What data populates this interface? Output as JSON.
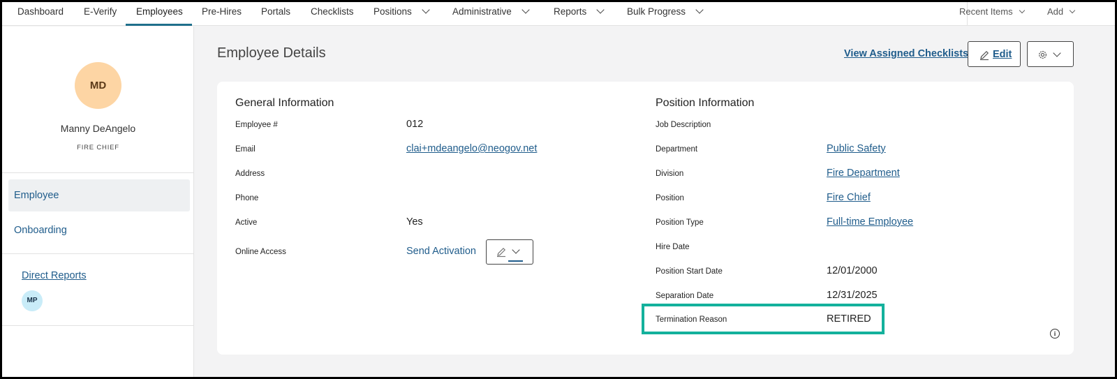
{
  "nav": {
    "items": [
      {
        "label": "Dashboard"
      },
      {
        "label": "E-Verify"
      },
      {
        "label": "Employees"
      },
      {
        "label": "Pre-Hires"
      },
      {
        "label": "Portals"
      },
      {
        "label": "Checklists"
      },
      {
        "label": "Positions"
      },
      {
        "label": "Administrative"
      },
      {
        "label": "Reports"
      },
      {
        "label": "Bulk Progress"
      }
    ],
    "active": "Employees",
    "recent_items": "Recent Items",
    "add": "Add"
  },
  "sidebar": {
    "avatar_initials": "MD",
    "name": "Manny DeAngelo",
    "title": "FIRE CHIEF",
    "items": [
      {
        "label": "Employee",
        "selected": true
      },
      {
        "label": "Onboarding",
        "selected": false
      }
    ],
    "direct_reports_label": "Direct Reports",
    "direct_reports": [
      {
        "initials": "MP"
      }
    ]
  },
  "main": {
    "title": "Employee Details",
    "view_checklists": "View Assigned Checklists",
    "edit_label": "Edit",
    "general": {
      "heading": "General Information",
      "employee_number_label": "Employee #",
      "employee_number": "012",
      "email_label": "Email",
      "email": "clai+mdeangelo@neogov.net",
      "address_label": "Address",
      "phone_label": "Phone",
      "active_label": "Active",
      "active": "Yes",
      "online_access_label": "Online Access",
      "send_activation": "Send Activation"
    },
    "position": {
      "heading": "Position Information",
      "job_description_label": "Job Description",
      "department_label": "Department",
      "department": "Public Safety",
      "division_label": "Division",
      "division": "Fire Department",
      "position_label": "Position",
      "position": "Fire Chief",
      "position_type_label": "Position Type",
      "position_type": "Full-time Employee",
      "hire_date_label": "Hire Date",
      "position_start_label": "Position Start Date",
      "position_start": "12/01/2000",
      "separation_label": "Separation Date",
      "separation": "12/31/2025",
      "termination_label": "Termination Reason",
      "termination": "RETIRED"
    }
  },
  "colors": {
    "accent": "#1f6f8b",
    "link": "#1f5c8b",
    "highlight": "#14b19c",
    "avatar_big": "#fdd5a4",
    "avatar_small": "#c9ecf8"
  }
}
